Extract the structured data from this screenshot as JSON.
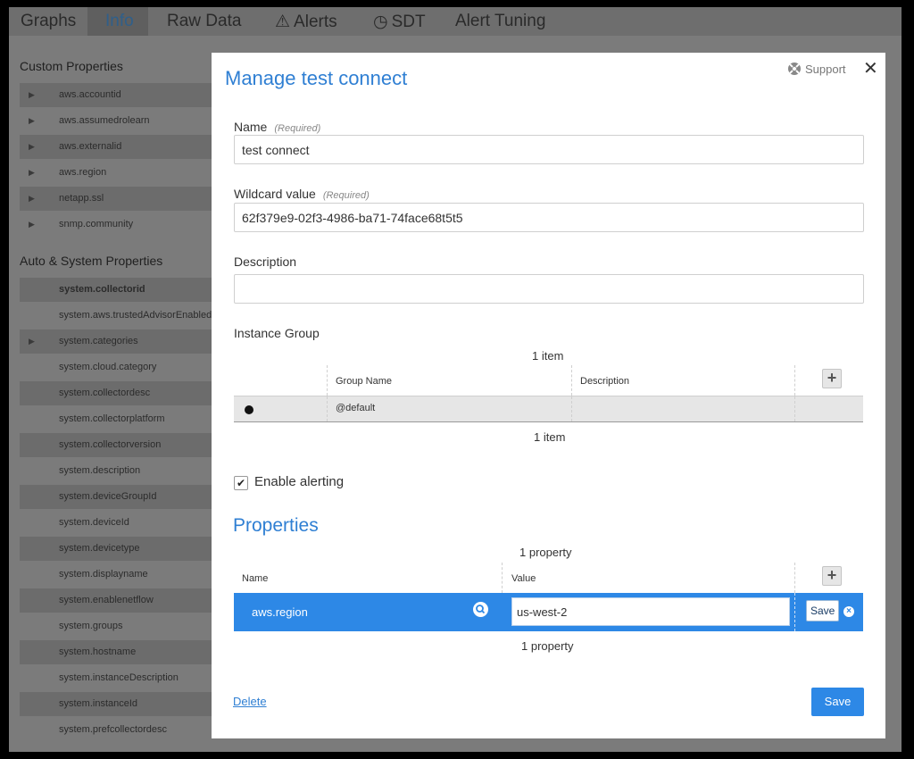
{
  "tabs": [
    {
      "label": "Graphs"
    },
    {
      "label": "Info"
    },
    {
      "label": "Raw Data"
    },
    {
      "label": "Alerts",
      "icon": "warning-icon"
    },
    {
      "label": "SDT",
      "icon": "clock-icon"
    },
    {
      "label": "Alert Tuning"
    }
  ],
  "sidebar": {
    "custom_heading": "Custom Properties",
    "custom_items": [
      "aws.accountid",
      "aws.assumedrolearn",
      "aws.externalid",
      "aws.region",
      "netapp.ssl",
      "snmp.community"
    ],
    "system_heading": "Auto & System Properties",
    "system_items": [
      "system.collectorid",
      "system.aws.trustedAdvisorEnabled",
      "system.categories",
      "system.cloud.category",
      "system.collectordesc",
      "system.collectorplatform",
      "system.collectorversion",
      "system.description",
      "system.deviceGroupId",
      "system.deviceId",
      "system.devicetype",
      "system.displayname",
      "system.enablenetflow",
      "system.groups",
      "system.hostname",
      "system.instanceDescription",
      "system.instanceId",
      "system.prefcollectordesc"
    ]
  },
  "modal": {
    "title": "Manage test connect",
    "support_label": "Support",
    "name_label": "Name",
    "required_note": "(Required)",
    "name_value": "test connect",
    "wildcard_label": "Wildcard value",
    "wildcard_value": "62f379e9-02f3-4986-ba71-74face68t5t5",
    "description_label": "Description",
    "description_value": "",
    "instance_group_label": "Instance Group",
    "group_count_top": "1 item",
    "group_count_bottom": "1 item",
    "group_columns": [
      "Group Name",
      "Description"
    ],
    "group_row": {
      "name": "@default",
      "description": ""
    },
    "enable_alerting_label": "Enable alerting",
    "enable_alerting_checked": true,
    "properties_title": "Properties",
    "prop_count_top": "1 property",
    "prop_count_bottom": "1 property",
    "prop_columns": [
      "Name",
      "Value"
    ],
    "prop_row": {
      "name": "aws.region",
      "value": "us-west-2",
      "save_label": "Save"
    },
    "delete_label": "Delete",
    "save_label": "Save"
  },
  "colors": {
    "accent": "#2d88e6",
    "title": "#2f7fd3"
  }
}
